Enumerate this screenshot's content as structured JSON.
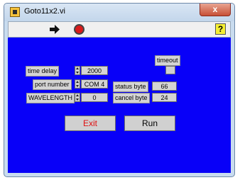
{
  "window": {
    "title": "Goto11x2.vi",
    "close_label": "x"
  },
  "toolbar": {
    "help_label": "?"
  },
  "panel": {
    "time_delay": {
      "label": "time delay",
      "value": "2000"
    },
    "port_number": {
      "label": "port number",
      "value": "COM 4"
    },
    "wavelength": {
      "label": "WAVELENGTH",
      "value": "0"
    },
    "timeout": {
      "label": "timeout"
    },
    "status_byte": {
      "label": "status byte",
      "value": "66"
    },
    "cancel_byte": {
      "label": "cancel byte",
      "value": "24"
    },
    "exit_button": {
      "label": "Exit",
      "color": "#e01010"
    },
    "run_button": {
      "label": "Run"
    },
    "background_color": "#0800f8"
  }
}
